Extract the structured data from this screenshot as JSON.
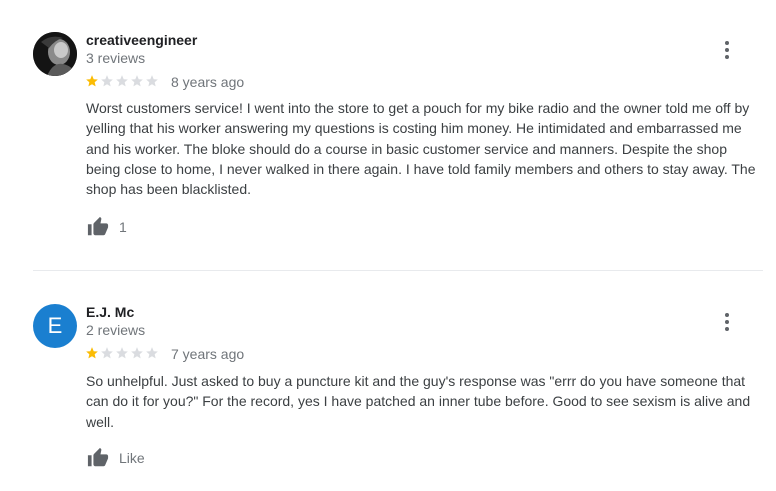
{
  "reviews": [
    {
      "name": "creativeengineer",
      "review_count": "3 reviews",
      "rating": 1,
      "max_rating": 5,
      "time": "8 years ago",
      "text": "Worst customers service! I went into the store to get a pouch for my bike radio and the owner told me off by yelling that his worker answering my questions is costing him money. He intimidated and embarrassed me and his worker. The bloke should do a course in basic customer service and manners. Despite the shop being close to home, I never walked in there again. I have told family members and others to stay away. The shop has been blacklisted.",
      "like_label": "1",
      "avatar_icon": "user-photo-avatar"
    },
    {
      "name": "E.J. Mc",
      "avatar_letter": "E",
      "avatar_color": "#1a7fd0",
      "review_count": "2 reviews",
      "rating": 1,
      "max_rating": 5,
      "time": "7 years ago",
      "text": "So unhelpful. Just asked to buy a puncture kit and the guy's response was \"errr do you have someone that can do it for you?\" For the record, yes I have patched an inner tube before. Good to see sexism is alive and well.",
      "like_label": "Like"
    }
  ],
  "colors": {
    "star_filled": "#fbbc04",
    "star_empty": "#dadce0",
    "muted": "#70757a"
  },
  "icons": {
    "like": "thumbs-up-icon",
    "menu": "more-vert-icon",
    "star": "star-icon"
  }
}
